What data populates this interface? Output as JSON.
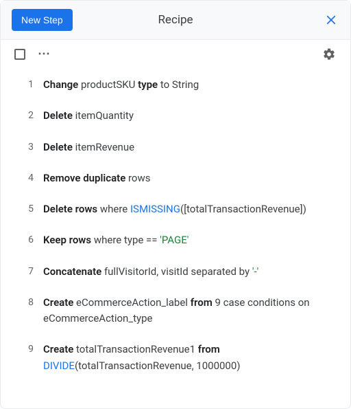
{
  "header": {
    "new_step_label": "New Step",
    "title": "Recipe"
  },
  "steps": [
    {
      "num": "1",
      "tokens": [
        {
          "t": "Change ",
          "cls": "b"
        },
        {
          "t": "productSKU "
        },
        {
          "t": "type ",
          "cls": "b"
        },
        {
          "t": "to String"
        }
      ]
    },
    {
      "num": "2",
      "tokens": [
        {
          "t": "Delete ",
          "cls": "b"
        },
        {
          "t": "itemQuantity"
        }
      ]
    },
    {
      "num": "3",
      "tokens": [
        {
          "t": "Delete ",
          "cls": "b"
        },
        {
          "t": "itemRevenue"
        }
      ]
    },
    {
      "num": "4",
      "tokens": [
        {
          "t": "Remove duplicate ",
          "cls": "b"
        },
        {
          "t": "rows"
        }
      ]
    },
    {
      "num": "5",
      "tokens": [
        {
          "t": "Delete rows ",
          "cls": "b"
        },
        {
          "t": "where "
        },
        {
          "t": "ISMISSING",
          "cls": "fn"
        },
        {
          "t": "([totalTransactionRevenue])"
        }
      ]
    },
    {
      "num": "6",
      "tokens": [
        {
          "t": "Keep rows ",
          "cls": "b"
        },
        {
          "t": "where type == "
        },
        {
          "t": "'PAGE'",
          "cls": "str"
        }
      ]
    },
    {
      "num": "7",
      "tokens": [
        {
          "t": "Concatenate ",
          "cls": "b"
        },
        {
          "t": "fullVisitorId, visitId separated by "
        },
        {
          "t": "'-'",
          "cls": "str"
        }
      ]
    },
    {
      "num": "8",
      "tokens": [
        {
          "t": "Create ",
          "cls": "b"
        },
        {
          "t": "eCommerceAction_label "
        },
        {
          "t": "from ",
          "cls": "b"
        },
        {
          "t": "9 case conditions on eCommerceAction_type"
        }
      ]
    },
    {
      "num": "9",
      "tokens": [
        {
          "t": "Create ",
          "cls": "b"
        },
        {
          "t": "totalTransactionRevenue1 "
        },
        {
          "t": "from ",
          "cls": "b"
        },
        {
          "t": "DIVIDE",
          "cls": "fn"
        },
        {
          "t": "(totalTransactionRevenue, 1000000)"
        }
      ]
    }
  ]
}
